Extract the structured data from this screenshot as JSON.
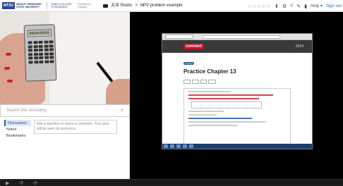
{
  "header": {
    "logo_mark": "MTSU",
    "university": "MIDDLE TENNESSEE STATE UNIVERSITY",
    "college": "JONES COLLEGE OF BUSINESS",
    "powered_by": "Powered by Panopto",
    "studio_title": "JCB Studio",
    "separator": ">",
    "recording_title": "NPV problem example",
    "rating_stars": "☆☆☆☆☆",
    "help_label": "Help",
    "signout_label": "Sign out"
  },
  "calculator": {
    "display": "00000000"
  },
  "search": {
    "placeholder": "Search this recording"
  },
  "side_tabs": [
    {
      "label": "Discussion",
      "active": true
    },
    {
      "label": "Notes",
      "active": false
    },
    {
      "label": "Bookmarks",
      "active": false
    }
  ],
  "discussion": {
    "placeholder": "Ask a question or share a comment. Your post will be seen by everyone."
  },
  "screen": {
    "brand": "connect",
    "year_line": "2014",
    "badge": "Connect",
    "practice_title": "Practice Chapter 13"
  },
  "icons": {
    "download": "download-icon",
    "settings": "gear-icon",
    "share": "share-icon",
    "edit": "pencil-icon",
    "stats": "bar-chart-icon",
    "search": "search-icon"
  },
  "colors": {
    "brand_blue": "#2a4b8d",
    "link_blue": "#1a73c8",
    "connect_red": "#c8102e"
  }
}
